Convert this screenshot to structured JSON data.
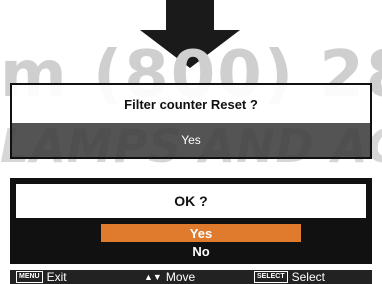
{
  "watermark": {
    "line1": "m (800) 28",
    "line2": "LAMPS AND ACCES"
  },
  "dialog_filter": {
    "title": "Filter counter  Reset ?",
    "value": "Yes"
  },
  "dialog_confirm": {
    "question": "OK ?",
    "options": [
      "Yes",
      "No"
    ],
    "selected": "Yes",
    "highlight_color": "#e07a2c"
  },
  "footer": {
    "exit_key": "MENU",
    "exit_label": "Exit",
    "move_label": "Move",
    "select_key": "SELECT",
    "select_label": "Select"
  },
  "icons": {
    "arrow": "down-arrow-icon",
    "move": "up-down-icon"
  }
}
